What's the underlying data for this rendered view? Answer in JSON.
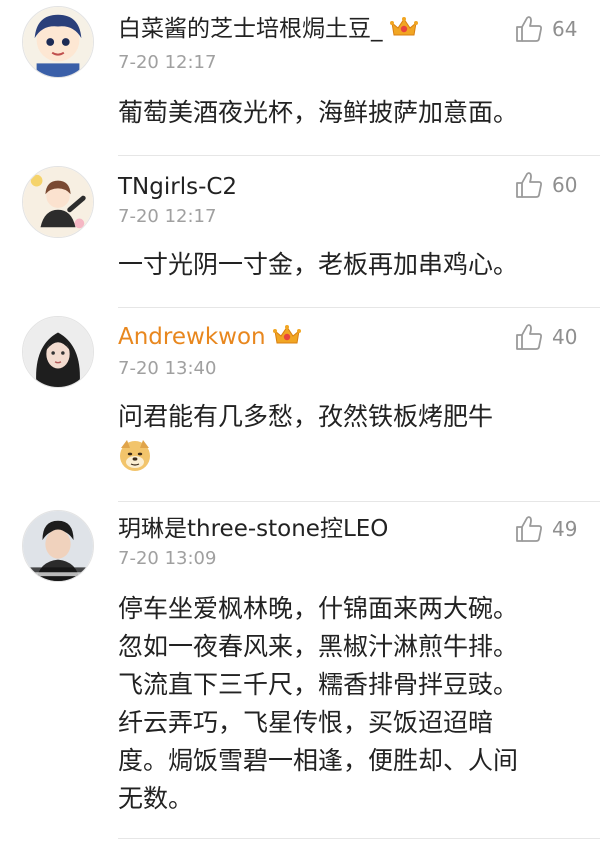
{
  "comments": [
    {
      "username": "白菜酱的芝士培根焗土豆_",
      "timestamp": "7-20 12:17",
      "likes": "64",
      "content": [
        "葡萄美酒夜光杯，海鲜披萨加意面。"
      ]
    },
    {
      "username": "TNgirls-C2",
      "timestamp": "7-20 12:17",
      "likes": "60",
      "content": [
        "一寸光阴一寸金，老板再加串鸡心。"
      ]
    },
    {
      "username": "Andrewkwon",
      "timestamp": "7-20 13:40",
      "likes": "40",
      "content": [
        "问君能有几多愁，孜然铁板烤肥牛"
      ]
    },
    {
      "username": "玥琳是three-stone控LEO",
      "timestamp": "7-20 13:09",
      "likes": "49",
      "content": [
        "停车坐爱枫林晚，什锦面来两大碗。",
        "忽如一夜春风来，黑椒汁淋煎牛排。",
        "飞流直下三千尺，糯香排骨拌豆豉。",
        "纤云弄巧，飞星传恨，买饭迢迢暗",
        "度。焗饭雪碧一相逢，便胜却、人间",
        "无数。"
      ]
    }
  ],
  "colors": {
    "vip_username": "#e8871e",
    "timestamp": "#a0a0a0",
    "like_count": "#8f8f8f"
  },
  "icons": {
    "like": "thumbs-up-icon",
    "vip": "crown-icon",
    "emoji": "doge-emoji-icon"
  }
}
